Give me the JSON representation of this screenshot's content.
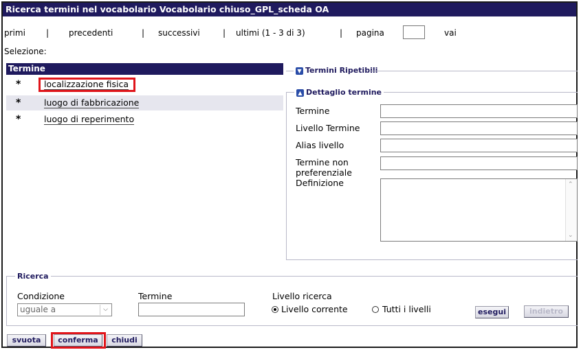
{
  "window": {
    "title": "Ricerca termini nel vocabolario Vocabolario chiuso_GPL_scheda OA"
  },
  "pagination": {
    "first": "primi",
    "sep": "|",
    "previous": "precedenti",
    "next": "successivi",
    "last": "ultimi (1 - 3 di 3)",
    "page_label": "pagina",
    "page_value": "",
    "go": "vai"
  },
  "selection_label": "Selezione:",
  "term_list": {
    "header": "Termine",
    "bullet": "*",
    "items": [
      {
        "label": "localizzazione fisica"
      },
      {
        "label": "luogo di fabbricazione"
      },
      {
        "label": "luogo di reperimento"
      }
    ]
  },
  "sections": {
    "repeated": "Termini Ripetibili",
    "detail": "Dettaglio termine",
    "collapse_icon": "triangle-down",
    "expand_icon": "triangle-up"
  },
  "detail": {
    "term_label": "Termine",
    "level_label": "Livello Termine",
    "alias_label": "Alias livello",
    "nonpref_label_1": "Termine non",
    "nonpref_label_2": "preferenziale",
    "definition_label": "Definizione",
    "term_value": "",
    "level_value": "",
    "alias_value": "",
    "nonpref_value": "",
    "definition_value": ""
  },
  "search": {
    "legend": "Ricerca",
    "condition_label": "Condizione",
    "condition_value": "uguale a",
    "term_label": "Termine",
    "term_value": "",
    "level_label": "Livello ricerca",
    "level_current": "Livello corrente",
    "level_all": "Tutti i livelli",
    "selected_level": "Livello corrente",
    "execute": "esegui",
    "back": "indietro"
  },
  "footer": {
    "clear": "svuota",
    "confirm": "conferma",
    "close": "chiudi"
  },
  "colors": {
    "header_bg": "#1f1a5e",
    "highlight": "#e0141a",
    "row_alt": "#e6e6ee"
  }
}
